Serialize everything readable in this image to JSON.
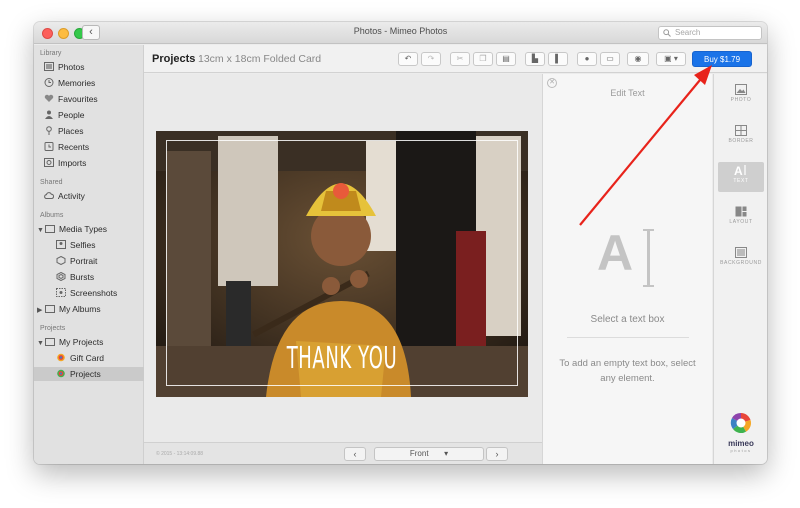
{
  "window": {
    "title": "Photos - Mimeo Photos"
  },
  "search": {
    "placeholder": "Search"
  },
  "sidebar": {
    "library_label": "Library",
    "library_items": [
      "Photos",
      "Memories",
      "Favourites",
      "People",
      "Places",
      "Recents",
      "Imports"
    ],
    "shared_label": "Shared",
    "shared_items": [
      "Activity"
    ],
    "albums_label": "Albums",
    "media_types": "Media Types",
    "media_items": [
      "Selfies",
      "Portrait",
      "Bursts",
      "Screenshots"
    ],
    "my_albums": "My Albums",
    "projects_label": "Projects",
    "my_projects": "My Projects",
    "project_items": [
      "Gift Card",
      "Projects"
    ]
  },
  "toolbar": {
    "title": "Projects",
    "subtitle": "13cm x 18cm Folded Card",
    "buy_label": "Buy $1.79"
  },
  "canvas": {
    "card_text": "THANK YOU",
    "copyright": "© 2015 - 13:14:09.88",
    "page_select": "Front"
  },
  "panel": {
    "title": "Edit Text",
    "select_prompt": "Select a text box",
    "hint": "To add an empty text box, select any element."
  },
  "rail": {
    "items": [
      "PHOTO",
      "BORDER",
      "TEXT",
      "LAYOUT",
      "BACKGROUND"
    ],
    "active": "TEXT"
  },
  "logo": {
    "name": "mimeo",
    "sub": "photos"
  },
  "colors": {
    "accent": "#1a73e8",
    "annotation": "#e8231b"
  }
}
